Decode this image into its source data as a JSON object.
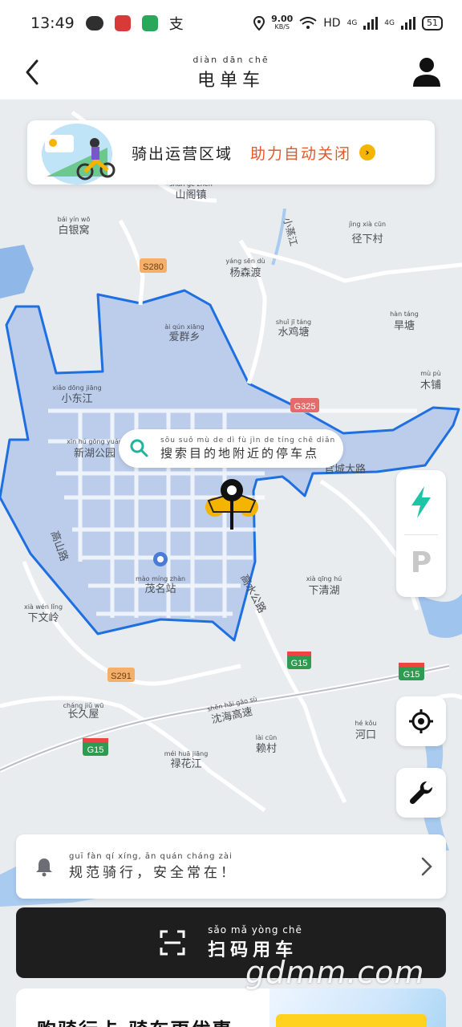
{
  "status_bar": {
    "time": "13:49",
    "net_speed_value": "9.00",
    "net_speed_unit": "KB/S",
    "hd_label": "HD",
    "network_1": "4G",
    "network_2": "4G",
    "battery": "51"
  },
  "header": {
    "title_pinyin": "diàn dān chē",
    "title": "电单车"
  },
  "banner": {
    "text": "骑出运营区域",
    "highlight": "助力自动关闭"
  },
  "search": {
    "pinyin": "sōu suǒ mù de dì fù jìn de tíng chē diǎn",
    "label": "搜索目的地附近的停车点"
  },
  "side_panel": {
    "parking_label": "P"
  },
  "map_labels": [
    {
      "text": "山阁镇",
      "py": "shān gé zhèn"
    },
    {
      "text": "白银窝",
      "py": "bái yín wō"
    },
    {
      "text": "小蒸江",
      "py": "xiǎo zhēng jiāng"
    },
    {
      "text": "径下村",
      "py": "jìng xià cūn"
    },
    {
      "text": "杨森渡",
      "py": "yáng sēn dù"
    },
    {
      "text": "S280",
      "py": ""
    },
    {
      "text": "爱群乡",
      "py": "ài qún xiāng"
    },
    {
      "text": "水鸡塘",
      "py": "shuǐ jī táng"
    },
    {
      "text": "旱塘",
      "py": "hàn táng"
    },
    {
      "text": "小东江",
      "py": "xiǎo dōng jiāng"
    },
    {
      "text": "G325",
      "py": ""
    },
    {
      "text": "木铺",
      "py": "mù pù"
    },
    {
      "text": "新湖公园",
      "py": "xīn hú gōng yuán"
    },
    {
      "text": "官城大路",
      "py": ""
    },
    {
      "text": "高山路",
      "py": "gāo shān lù"
    },
    {
      "text": "茂名站",
      "py": "mào míng zhàn"
    },
    {
      "text": "高水公路",
      "py": "gāo shuǐ gōng lù"
    },
    {
      "text": "下清湖",
      "py": "xià qīng hú"
    },
    {
      "text": "下文岭",
      "py": "xià wén lǐng"
    },
    {
      "text": "G15",
      "py": ""
    },
    {
      "text": "S291",
      "py": ""
    },
    {
      "text": "长久屋",
      "py": "cháng jiǔ wū"
    },
    {
      "text": "沈海高速",
      "py": "shěn hǎi gāo sù"
    },
    {
      "text": "赖村",
      "py": "lài cūn"
    },
    {
      "text": "河口",
      "py": "hé kǒu"
    },
    {
      "text": "禄花江",
      "py": "méi huā jiāng"
    }
  ],
  "notice": {
    "pinyin": "guī fàn qí xíng, ān quán cháng zài",
    "text": "规范骑行，安全常在！"
  },
  "scan_button": {
    "pinyin": "sǎo mǎ yòng chē",
    "label": "扫码用车"
  },
  "promo": {
    "text": "购骑行卡 骑车更优惠"
  },
  "watermark": "gdmm.com",
  "colors": {
    "zone_fill": "#b4c8eb",
    "zone_stroke": "#1e6fe0",
    "highlight": "#e8572a",
    "brand_yellow": "#f5b400",
    "bolt": "#1cc5a6",
    "button_dark": "#1e1e1e"
  }
}
